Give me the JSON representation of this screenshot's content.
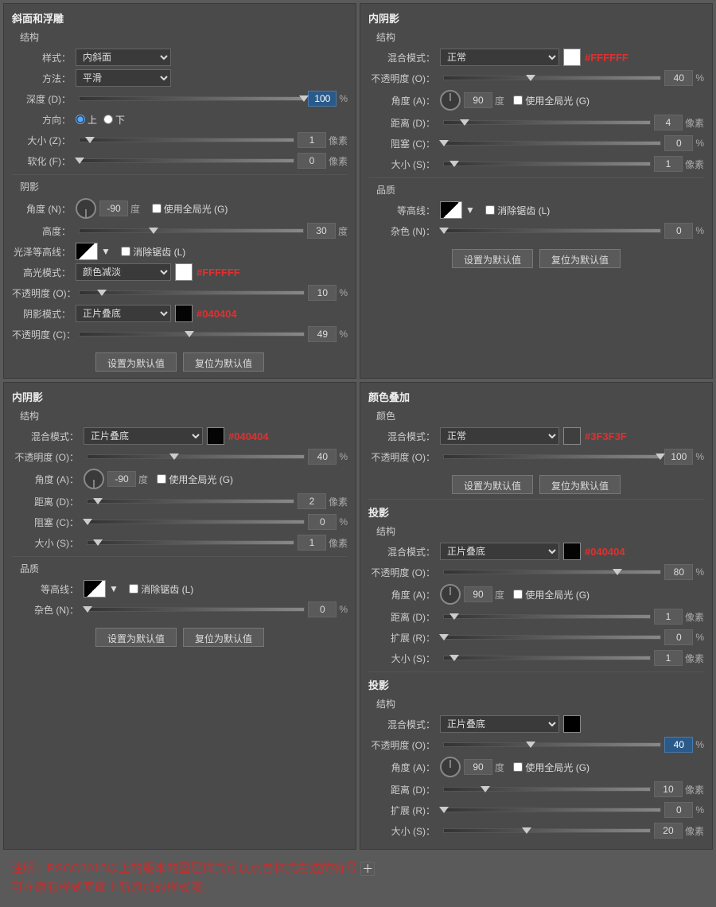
{
  "panels": {
    "bevel_emboss": {
      "title": "斜面和浮雕",
      "section": "结构",
      "style_label": "样式：",
      "style_value": "内斜面",
      "method_label": "方法：",
      "method_value": "平滑",
      "depth_label": "深度 (D)：",
      "depth_value": "100",
      "depth_unit": "%",
      "direction_label": "方向：",
      "dir_up": "上",
      "dir_down": "下",
      "size_label": "大小 (Z)：",
      "size_value": "1",
      "size_unit": "像素",
      "soften_label": "软化 (F)：",
      "soften_value": "0",
      "soften_unit": "像素",
      "shadow_section": "阴影",
      "angle_label": "角度 (N)：",
      "angle_value": "-90",
      "angle_unit": "度",
      "global_light_label": "使用全局光 (G)",
      "altitude_label": "高度：",
      "altitude_value": "30",
      "altitude_unit": "度",
      "gloss_contour_label": "光泽等高线：",
      "anti_alias_label": "消除锯齿 (L)",
      "highlight_mode_label": "高光模式：",
      "highlight_mode_value": "颜色减淡",
      "highlight_color": "#FFFFFF",
      "highlight_color_label": "#FFFFFF",
      "highlight_opacity_label": "不透明度 (O)：",
      "highlight_opacity_value": "10",
      "highlight_opacity_unit": "%",
      "shadow_mode_label": "阴影模式：",
      "shadow_mode_value": "正片叠底",
      "shadow_color": "#040404",
      "shadow_color_label": "#040404",
      "shadow_opacity_label": "不透明度 (C)：",
      "shadow_opacity_value": "49",
      "shadow_opacity_unit": "%",
      "btn_set_default": "设置为默认值",
      "btn_reset_default": "复位为默认值"
    },
    "inner_shadow_top": {
      "title": "内阴影",
      "section": "结构",
      "blend_mode_label": "混合模式：",
      "blend_mode_value": "正常",
      "blend_color": "#FFFFFF",
      "blend_color_label": "#FFFFFF",
      "opacity_label": "不透明度 (O)：",
      "opacity_value": "40",
      "opacity_unit": "%",
      "angle_label": "角度 (A)：",
      "angle_value": "90",
      "angle_unit": "度",
      "global_light_label": "使用全局光 (G)",
      "distance_label": "距离 (D)：",
      "distance_value": "4",
      "distance_unit": "像素",
      "choke_label": "阻塞 (C)：",
      "choke_value": "0",
      "choke_unit": "%",
      "size_label": "大小 (S)：",
      "size_value": "1",
      "size_unit": "像素",
      "quality_section": "品质",
      "contour_label": "等高线：",
      "anti_alias_label": "消除锯齿 (L)",
      "noise_label": "杂色 (N)：",
      "noise_value": "0",
      "noise_unit": "%",
      "btn_set_default": "设置为默认值",
      "btn_reset_default": "复位为默认值"
    },
    "inner_shadow_bottom": {
      "title": "内阴影",
      "section": "结构",
      "blend_mode_label": "混合模式：",
      "blend_mode_value": "正片叠底",
      "blend_color": "#040404",
      "blend_color_label": "#040404",
      "opacity_label": "不透明度 (O)：",
      "opacity_value": "40",
      "opacity_unit": "%",
      "angle_label": "角度 (A)：",
      "angle_value": "-90",
      "angle_unit": "度",
      "global_light_label": "使用全局光 (G)",
      "distance_label": "距离 (D)：",
      "distance_value": "2",
      "distance_unit": "像素",
      "choke_label": "阻塞 (C)：",
      "choke_value": "0",
      "choke_unit": "%",
      "size_label": "大小 (S)：",
      "size_value": "1",
      "size_unit": "像素",
      "quality_section": "品质",
      "contour_label": "等高线：",
      "anti_alias_label": "消除锯齿 (L)",
      "noise_label": "杂色 (N)：",
      "noise_value": "0",
      "noise_unit": "%",
      "btn_set_default": "设置为默认值",
      "btn_reset_default": "复位为默认值"
    },
    "color_overlay": {
      "title": "颜色叠加",
      "section": "颜色",
      "blend_mode_label": "混合模式：",
      "blend_mode_value": "正常",
      "blend_color": "#3F3F3F",
      "blend_color_label": "#3F3F3F",
      "opacity_label": "不透明度 (O)：",
      "opacity_value": "100",
      "opacity_unit": "%",
      "btn_set_default": "设置为默认值",
      "btn_reset_default": "复位为默认值"
    },
    "drop_shadow_1": {
      "title": "投影",
      "section": "结构",
      "blend_mode_label": "混合模式：",
      "blend_mode_value": "正片叠底",
      "blend_color": "#040404",
      "blend_color_label": "#040404",
      "opacity_label": "不透明度 (O)：",
      "opacity_value": "80",
      "opacity_unit": "%",
      "angle_label": "角度 (A)：",
      "angle_value": "90",
      "angle_unit": "度",
      "global_light_label": "使用全局光 (G)",
      "distance_label": "距离 (D)：",
      "distance_value": "1",
      "distance_unit": "像素",
      "spread_label": "扩展 (R)：",
      "spread_value": "0",
      "spread_unit": "%",
      "size_label": "大小 (S)：",
      "size_value": "1",
      "size_unit": "像素"
    },
    "drop_shadow_2": {
      "title": "投影",
      "section": "结构",
      "blend_mode_label": "混合模式：",
      "blend_mode_value": "正片叠底",
      "blend_color": "#000000",
      "blend_color_label": "#000000",
      "opacity_label": "不透明度 (O)：",
      "opacity_value": "40",
      "opacity_unit": "%",
      "angle_label": "角度 (A)：",
      "angle_value": "90",
      "angle_unit": "度",
      "global_light_label": "使用全局光 (G)",
      "distance_label": "距离 (D)：",
      "distance_value": "10",
      "distance_unit": "像素",
      "spread_label": "扩展 (R)：",
      "spread_value": "0",
      "spread_unit": "%",
      "size_label": "大小 (S)：",
      "size_value": "20",
      "size_unit": "像素"
    }
  },
  "note": {
    "prefix": "注明：PSCC2015以上的版本的图层样式可以点击样式右边的符号",
    "suffix": "可在原有样式基础上新添加的样式哦。",
    "icon": "＋"
  }
}
